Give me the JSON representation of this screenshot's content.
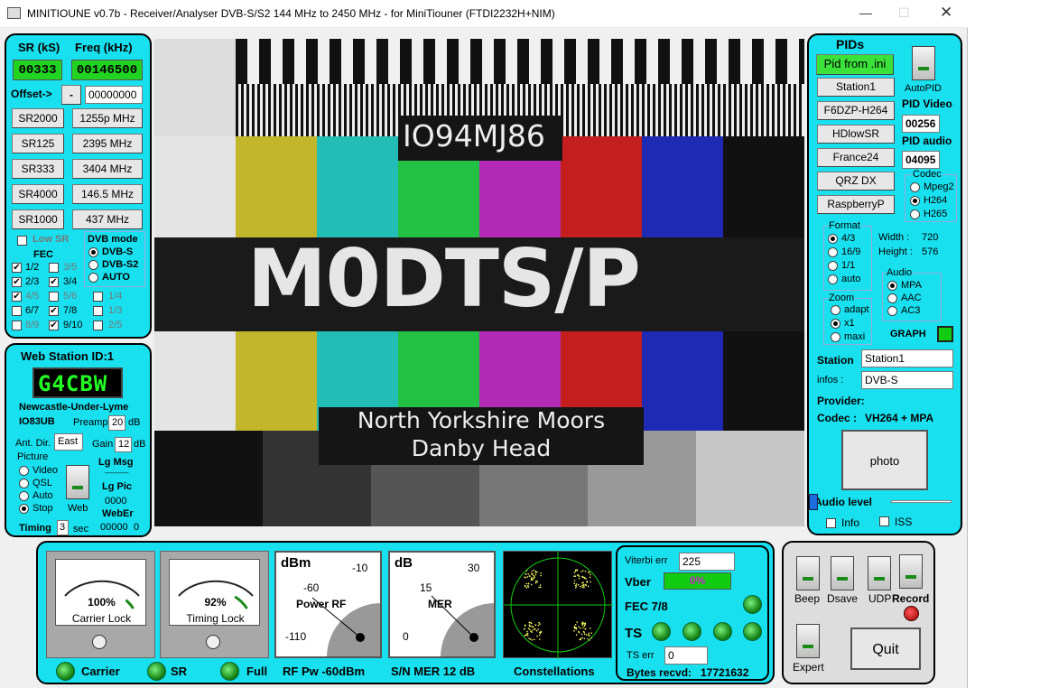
{
  "window": {
    "title": "MINITIOUNE v0.7b - Receiver/Analyser DVB-S/S2 144 MHz to 2450 MHz - for MiniTiouner (FTDI2232H+NIM)"
  },
  "left": {
    "sr_label": "SR (kS)",
    "freq_label": "Freq (kHz)",
    "sr_value": "00333",
    "freq_value": "00146500",
    "offset_label": "Offset->",
    "offset_sign": "-",
    "offset_value": "00000000",
    "sr_buttons": [
      "SR2000",
      "SR125",
      "SR333",
      "SR4000",
      "SR1000"
    ],
    "freq_buttons": [
      "1255p MHz",
      "2395 MHz",
      "3404 MHz",
      "146.5 MHz",
      "437 MHz"
    ],
    "low_sr": "Low SR",
    "fec_title": "FEC",
    "dvb_title": "DVB mode",
    "fec_left": [
      {
        "l": "1/2",
        "c": true
      },
      {
        "l": "2/3",
        "c": true
      },
      {
        "l": "4/5",
        "c": true
      },
      {
        "l": "6/7",
        "c": false
      },
      {
        "l": "8/9",
        "c": false
      }
    ],
    "fec_mid": [
      {
        "l": "3/5",
        "c": false
      },
      {
        "l": "3/4",
        "c": true
      },
      {
        "l": "5/6",
        "c": false
      },
      {
        "l": "7/8",
        "c": true
      },
      {
        "l": "9/10",
        "c": true
      }
    ],
    "fec_right": [
      "1/4",
      "1/3",
      "2/5"
    ],
    "dvb_modes": [
      {
        "l": "DVB-S",
        "on": true
      },
      {
        "l": "DVB-S2",
        "on": false
      },
      {
        "l": "AUTO",
        "on": false
      }
    ]
  },
  "web": {
    "title": "Web Station ID:1",
    "callsign": "G4CBW",
    "location": "Newcastle-Under-Lyme",
    "locator": "IO83UB",
    "preamp_label": "Preamp",
    "preamp": "20",
    "preamp_unit": "dB",
    "ant_label": "Ant. Dir.",
    "ant": "East",
    "gain_label": "Gain",
    "gain": "12",
    "gain_unit": "dB",
    "picture_label": "Picture",
    "picture_opts": [
      {
        "l": "Video",
        "on": false
      },
      {
        "l": "QSL",
        "on": false
      },
      {
        "l": "Auto",
        "on": false
      },
      {
        "l": "Stop",
        "on": true
      }
    ],
    "web_label": "Web",
    "lg_msg": "Lg Msg",
    "dashes": "----------",
    "lg_pic": "Lg Pic",
    "lg_pic_val": "0000",
    "weber": "WebEr",
    "weber_val": "00000",
    "weber_val2": "0",
    "timing": "Timing",
    "timing_val": "3",
    "sec": "sec"
  },
  "video": {
    "locator": "IO94MJ86",
    "callsign": "M0DTS/P",
    "line1": "North Yorkshire Moors",
    "line2": "Danby Head"
  },
  "right": {
    "pids_title": "PIDs",
    "pid_ini": "Pid from .ini",
    "autopid": "AutoPID",
    "stations": [
      "Station1",
      "F6DZP-H264",
      "HDlowSR",
      "France24",
      "QRZ DX",
      "RaspberryP"
    ],
    "pid_video_label": "PID Video",
    "pid_video": "00256",
    "pid_audio_label": "PID audio",
    "pid_audio": "04095",
    "codec_title": "Codec",
    "codecs": [
      {
        "l": "Mpeg2",
        "on": false
      },
      {
        "l": "H264",
        "on": true
      },
      {
        "l": "H265",
        "on": false
      }
    ],
    "format_title": "Format",
    "formats": [
      {
        "l": "4/3",
        "on": true
      },
      {
        "l": "16/9",
        "on": false
      },
      {
        "l": "1/1",
        "on": false
      },
      {
        "l": "auto",
        "on": false
      }
    ],
    "width_label": "Width :",
    "width": "720",
    "height_label": "Height :",
    "height": "576",
    "audio_title": "Audio",
    "audios": [
      {
        "l": "MPA",
        "on": true
      },
      {
        "l": "AAC",
        "on": false
      },
      {
        "l": "AC3",
        "on": false
      }
    ],
    "zoom_title": "Zoom",
    "zooms": [
      {
        "l": "adapt",
        "on": false
      },
      {
        "l": "x1",
        "on": true
      },
      {
        "l": "maxi",
        "on": false
      }
    ],
    "graph": "GRAPH",
    "station_label": "Station",
    "station_value": "Station1",
    "infos_label": "infos :",
    "infos_value": "DVB-S",
    "provider_label": "Provider:",
    "codec_label": "Codec :",
    "codec_value": "VH264 + MPA",
    "photo": "photo",
    "audio_level": "Audio level",
    "info": "Info",
    "iss": "ISS",
    "audio_level_value": 0.5
  },
  "bottom": {
    "carrier_pct": "100%",
    "carrier_caption": "Carrier Lock",
    "carrier_level": 1.0,
    "timing_pct": "92%",
    "timing_caption": "Timing Lock",
    "timing_level": 0.92,
    "dbm_unit": "dBm",
    "dbm_t1": "-10",
    "dbm_t2": "-60",
    "dbm_caption": "Power RF",
    "dbm_t3": "-110",
    "db_unit": "dB",
    "db_t1": "30",
    "db_t2": "15",
    "db_caption": "MER",
    "db_t3": "0",
    "ind_carrier": "Carrier",
    "ind_sr": "SR",
    "ind_full": "Full",
    "rf_pw": "RF Pw -60dBm",
    "sn_mer": "S/N MER  12 dB",
    "constellations": "Constellations"
  },
  "viterbi": {
    "viterbi_label": "Viterbi err",
    "viterbi": "225",
    "vber_label": "Vber",
    "vber": "0%",
    "fec": "FEC 7/8",
    "ts": "TS",
    "ts_err_label": "TS err",
    "ts_err": "0",
    "bytes_label": "Bytes recvd:",
    "bytes": "17721632"
  },
  "controls": {
    "beep": "Beep",
    "dsave": "Dsave",
    "udp": "UDP",
    "record": "Record",
    "expert": "Expert",
    "quit": "Quit"
  }
}
